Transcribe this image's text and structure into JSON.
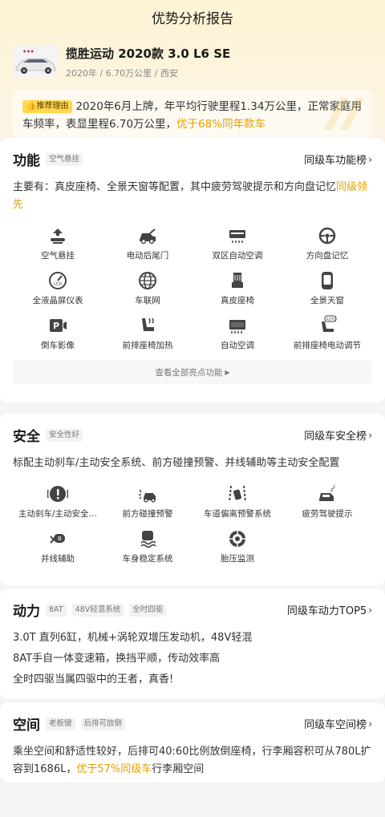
{
  "header": {
    "title": "优势分析报告"
  },
  "car": {
    "name": "揽胜运动 2020款 3.0 L6 SE",
    "meta": "2020年 / 6.70万公里 / 西安"
  },
  "reason": {
    "tag": "推荐理由",
    "text": "2020年6月上牌，年平均行驶里程1.34万公里，正常家庭用车频率，表显里程6.70万公里，",
    "highlight": "优于68%同年款车"
  },
  "function": {
    "title": "功能",
    "chip": "空气悬挂",
    "rank": "同级车功能榜",
    "desc": "主要有：真皮座椅、全景天窗等配置，其中疲劳驾驶提示和方向盘记忆",
    "desc_highlight": "同级领先",
    "items": [
      {
        "label": "空气悬挂",
        "icon": "air-suspension-icon"
      },
      {
        "label": "电动后尾门",
        "icon": "power-tailgate-icon"
      },
      {
        "label": "双区自动空调",
        "icon": "dual-zone-ac-icon"
      },
      {
        "label": "方向盘记忆",
        "icon": "steering-memory-icon"
      },
      {
        "label": "全液晶屏仪表",
        "icon": "lcd-cluster-icon"
      },
      {
        "label": "车联网",
        "icon": "connected-car-icon"
      },
      {
        "label": "真皮座椅",
        "icon": "leather-seat-icon"
      },
      {
        "label": "全景天窗",
        "icon": "panoramic-roof-icon"
      },
      {
        "label": "倒车影像",
        "icon": "reverse-camera-icon"
      },
      {
        "label": "前排座椅加热",
        "icon": "seat-heating-icon"
      },
      {
        "label": "自动空调",
        "icon": "auto-ac-icon"
      },
      {
        "label": "前排座椅电动调节",
        "icon": "power-seat-icon"
      }
    ],
    "view_all": "查看全部亮点功能"
  },
  "safety": {
    "title": "安全",
    "chip": "安全性好",
    "rank": "同级车安全榜",
    "desc": "标配主动刹车/主动安全系统、前方碰撞预警、并线辅助等主动安全配置",
    "items": [
      {
        "label": "主动刹车/主动安全…",
        "icon": "active-brake-icon"
      },
      {
        "label": "前方碰撞预警",
        "icon": "collision-warning-icon"
      },
      {
        "label": "车道偏离预警系统",
        "icon": "lane-departure-icon"
      },
      {
        "label": "疲劳驾驶提示",
        "icon": "fatigue-alert-icon"
      },
      {
        "label": "并线辅助",
        "icon": "blind-spot-icon"
      },
      {
        "label": "车身稳定系统",
        "icon": "stability-control-icon"
      },
      {
        "label": "胎压监测",
        "icon": "tire-pressure-icon"
      }
    ]
  },
  "power": {
    "title": "动力",
    "chips": [
      "8AT",
      "48V轻混系统",
      "全时四驱"
    ],
    "rank": "同级车动力TOP5",
    "lines": [
      "3.0T 直列6缸，机械+涡轮双增压发动机，48V轻混",
      "8AT手自一体变速箱，换挡平顺，传动效率高",
      "全时四驱当属四驱中的王者，真香!"
    ]
  },
  "space": {
    "title": "空间",
    "chips": [
      "老板键",
      "后排可放倒"
    ],
    "rank": "同级车空间榜",
    "desc": "乘坐空间和舒适性较好，后排可40:60比例放倒座椅，行李厢容积可从780L扩容到1686L，",
    "desc_highlight": "优于57%同级车",
    "desc_tail": "行李厢空间"
  },
  "colors": {
    "accent": "#e3a000",
    "tag_bg": "#ffd84d",
    "icon": "#444444"
  }
}
